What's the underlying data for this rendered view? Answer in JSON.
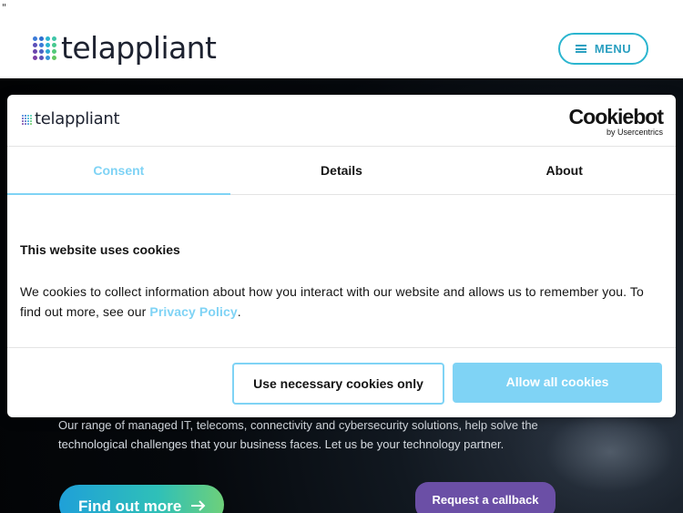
{
  "stray_text": "\"",
  "header": {
    "brand": "telappliant",
    "menu_label": "MENU"
  },
  "hero": {
    "description": "Our range of managed IT, telecoms, connectivity and cybersecurity solutions, help solve the technological challenges that your business faces. Let us be your technology partner.",
    "find_out_more": "Find out more",
    "request_callback": "Request a callback"
  },
  "cookie_dialog": {
    "brand": "telappliant",
    "cookiebot": {
      "name": "Cookiebot",
      "sub": "by Usercentrics"
    },
    "tabs": [
      {
        "label": "Consent",
        "active": true
      },
      {
        "label": "Details",
        "active": false
      },
      {
        "label": "About",
        "active": false
      }
    ],
    "title": "This website uses cookies",
    "body_prefix": "We cookies to collect information about how you interact with our website and allows us to remember you. To find out more, see our ",
    "link_text": "Privacy Policy",
    "body_suffix": ".",
    "btn_necessary": "Use necessary cookies only",
    "btn_allow": "Allow all cookies"
  },
  "colors": {
    "accent_cyan": "#7fd3f5",
    "menu_border": "#2bb5cf",
    "callback_purple": "#6b4fa6",
    "hero_dark": "#05080c"
  },
  "icons": {
    "brand_logo": "dot-grid-icon",
    "menu": "hamburger-icon",
    "find_out_more": "arrow-right-icon"
  }
}
